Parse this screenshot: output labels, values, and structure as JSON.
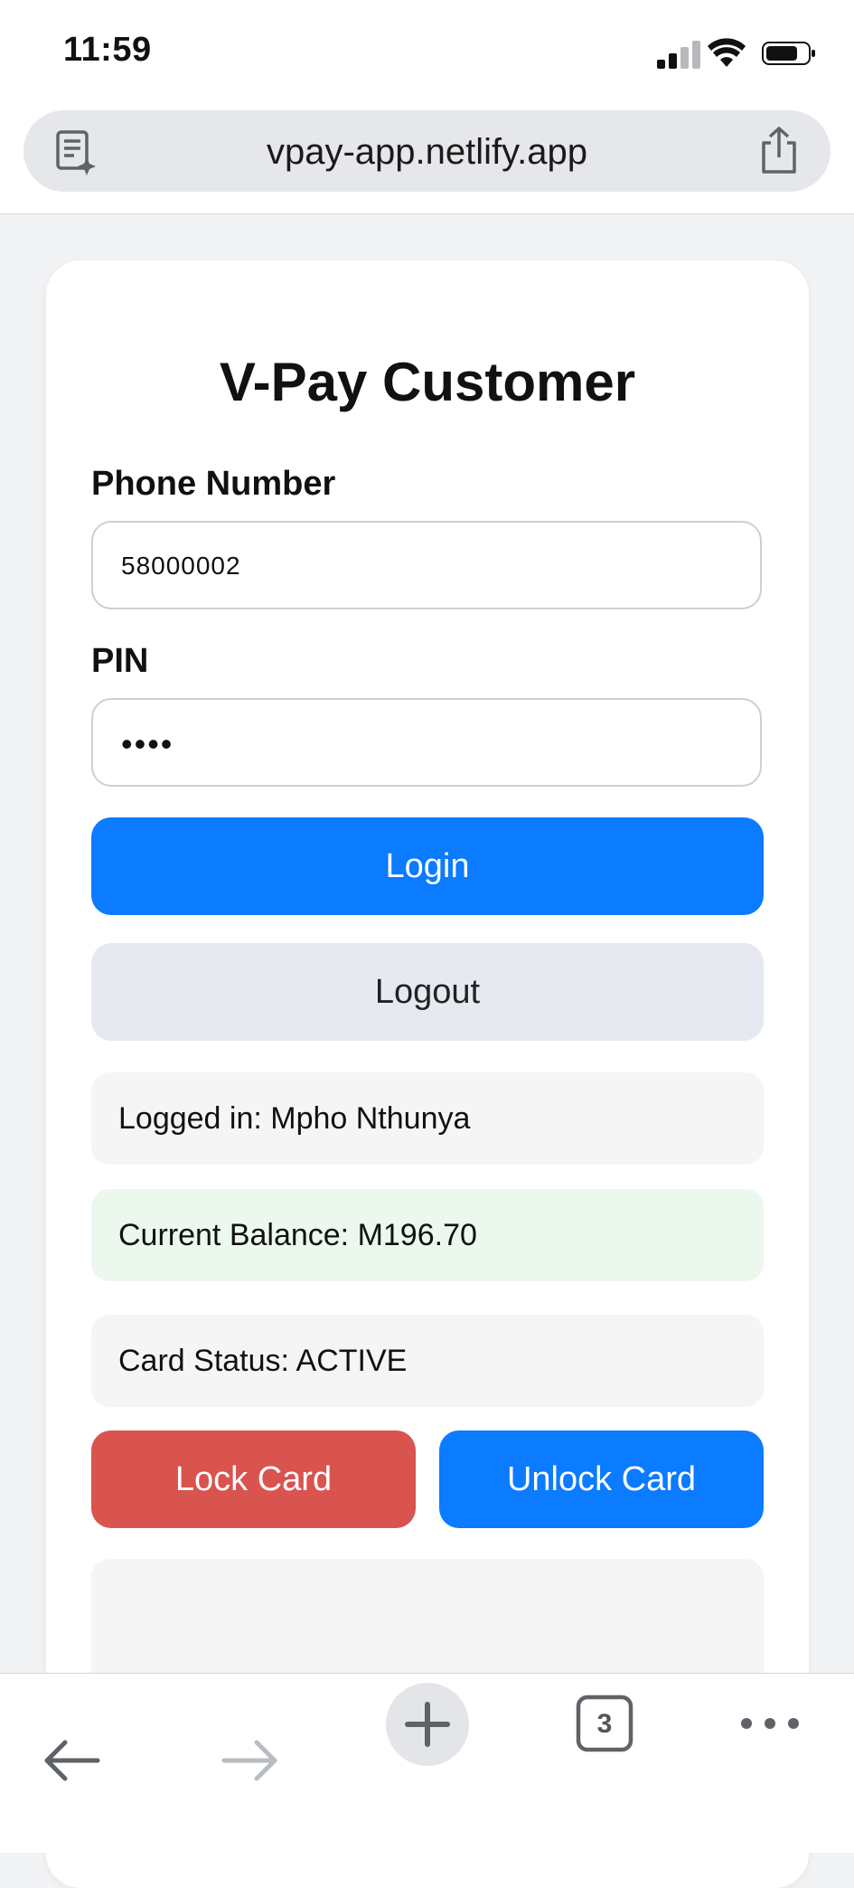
{
  "status_bar": {
    "time": "11:59"
  },
  "browser": {
    "url": "vpay-app.netlify.app",
    "tab_count": "3"
  },
  "form": {
    "title": "V-Pay Customer",
    "phone_label": "Phone Number",
    "phone_value": "58000002",
    "pin_label": "PIN",
    "pin_value": "••••",
    "login_label": "Login",
    "logout_label": "Logout"
  },
  "info": {
    "logged_in": "Logged in: Mpho Nthunya",
    "balance": "Current Balance: M196.70",
    "card_status": "Card Status: ACTIVE"
  },
  "card_actions": {
    "lock_label": "Lock Card",
    "unlock_label": "Unlock Card"
  },
  "colors": {
    "primary": "#0b7bff",
    "danger": "#d9534f",
    "balance_bg": "#ecf7ee"
  }
}
